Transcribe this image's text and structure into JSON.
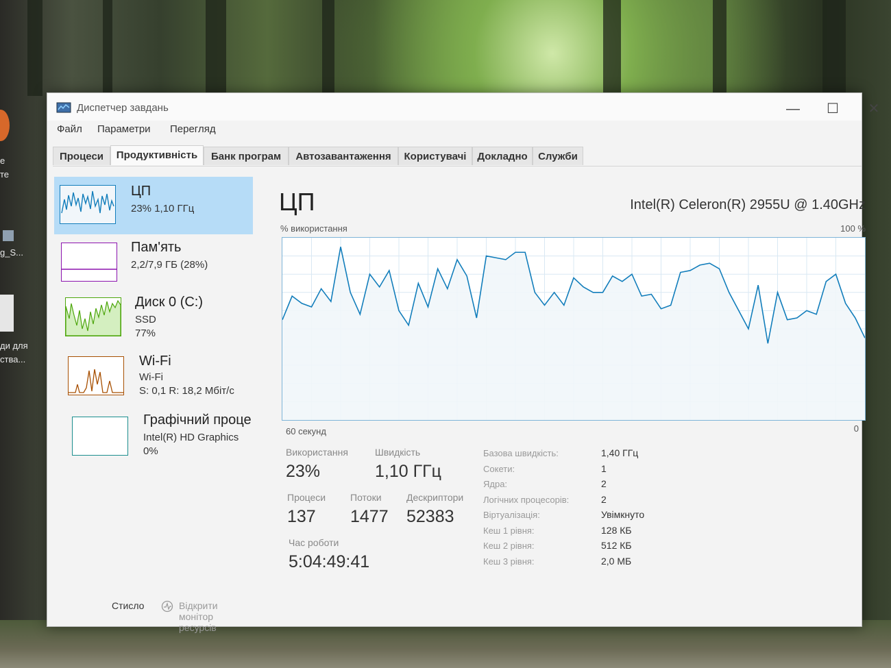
{
  "desktop": {
    "icon_labels": [
      "е",
      "те",
      "g_S...",
      "ди для",
      "ства..."
    ]
  },
  "window": {
    "title": "Диспетчер завдань",
    "controls": {
      "minimize": "—",
      "maximize": "☐",
      "close": "✕"
    }
  },
  "menu": [
    "Файл",
    "Параметри",
    "Перегляд"
  ],
  "tabs": [
    "Процеси",
    "Продуктивність",
    "Банк програм",
    "Автозавантаження",
    "Користувачі",
    "Докладно",
    "Служби"
  ],
  "active_tab": "Продуктивність",
  "sidebar": {
    "items": [
      {
        "title": "ЦП",
        "line1": "23% 1,10 ГГц",
        "line2": "",
        "line3": ""
      },
      {
        "title": "Пам'ять",
        "line1": "2,2/7,9 ГБ (28%)",
        "line2": "",
        "line3": ""
      },
      {
        "title": "Диск 0 (C:)",
        "line1": "SSD",
        "line2": "77%",
        "line3": ""
      },
      {
        "title": "Wi-Fi",
        "line1": "Wi-Fi",
        "line2": "S: 0,1 R: 18,2 Мбіт/с",
        "line3": ""
      },
      {
        "title": "Графічний проце",
        "line1": "Intel(R) HD Graphics",
        "line2": "0%",
        "line3": ""
      }
    ]
  },
  "main": {
    "title": "ЦП",
    "cpu_name": "Intel(R) Celeron(R) 2955U @ 1.40GHz",
    "graph_label": "% використання",
    "graph_max": "100 %",
    "graph_time": "60 секунд",
    "graph_min": "0",
    "stats": {
      "usage_label": "Використання",
      "usage_value": "23%",
      "speed_label": "Швидкість",
      "speed_value": "1,10 ГГц",
      "processes_label": "Процеси",
      "processes_value": "137",
      "threads_label": "Потоки",
      "threads_value": "1477",
      "handles_label": "Дескриптори",
      "handles_value": "52383",
      "uptime_label": "Час роботи",
      "uptime_value": "5:04:49:41"
    },
    "details": [
      {
        "key": "Базова швидкість:",
        "value": "1,40 ГГц"
      },
      {
        "key": "Сокети:",
        "value": "1"
      },
      {
        "key": "Ядра:",
        "value": "2"
      },
      {
        "key": "Логічних процесорів:",
        "value": "2"
      },
      {
        "key": "Віртуалізація:",
        "value": "Увімкнуто"
      },
      {
        "key": "Кеш 1 рівня:",
        "value": "128 КБ"
      },
      {
        "key": "Кеш 2 рівня:",
        "value": "512 КБ"
      },
      {
        "key": "Кеш 3 рівня:",
        "value": "2,0 МБ"
      }
    ]
  },
  "footer": {
    "fewer_details": "Стисло",
    "resource_monitor": "Відкрити монітор ресурсів"
  },
  "chart_data": {
    "type": "area",
    "x": [
      60,
      59,
      58,
      57,
      56,
      55,
      54,
      53,
      52,
      51,
      50,
      49,
      48,
      47,
      46,
      45,
      44,
      43,
      42,
      41,
      40,
      39,
      38,
      37,
      36,
      35,
      34,
      33,
      32,
      31,
      30,
      29,
      28,
      27,
      26,
      25,
      24,
      23,
      22,
      21,
      20,
      19,
      18,
      17,
      16,
      15,
      14,
      13,
      12,
      11,
      10,
      9,
      8,
      7,
      6,
      5,
      4,
      3,
      2,
      1,
      0
    ],
    "series": [
      {
        "values": [
          55,
          68,
          64,
          62,
          72,
          65,
          95,
          70,
          58,
          80,
          73,
          82,
          60,
          52,
          75,
          62,
          83,
          72,
          88,
          79,
          56,
          90,
          89,
          88,
          92,
          92,
          70,
          63,
          70,
          63,
          78,
          73,
          70,
          70,
          79,
          76,
          80,
          68,
          69,
          61,
          63,
          81,
          82,
          85,
          86,
          83,
          70,
          60,
          50,
          74,
          42,
          70,
          55,
          56,
          60,
          58,
          76,
          80,
          64,
          56,
          45
        ]
      }
    ],
    "ylim": [
      0,
      100
    ]
  },
  "colors": {
    "accent": "#117dbb",
    "fill": "#f1f6fa",
    "grid": "#d9e8f3",
    "selected": "#b6dcf7"
  }
}
